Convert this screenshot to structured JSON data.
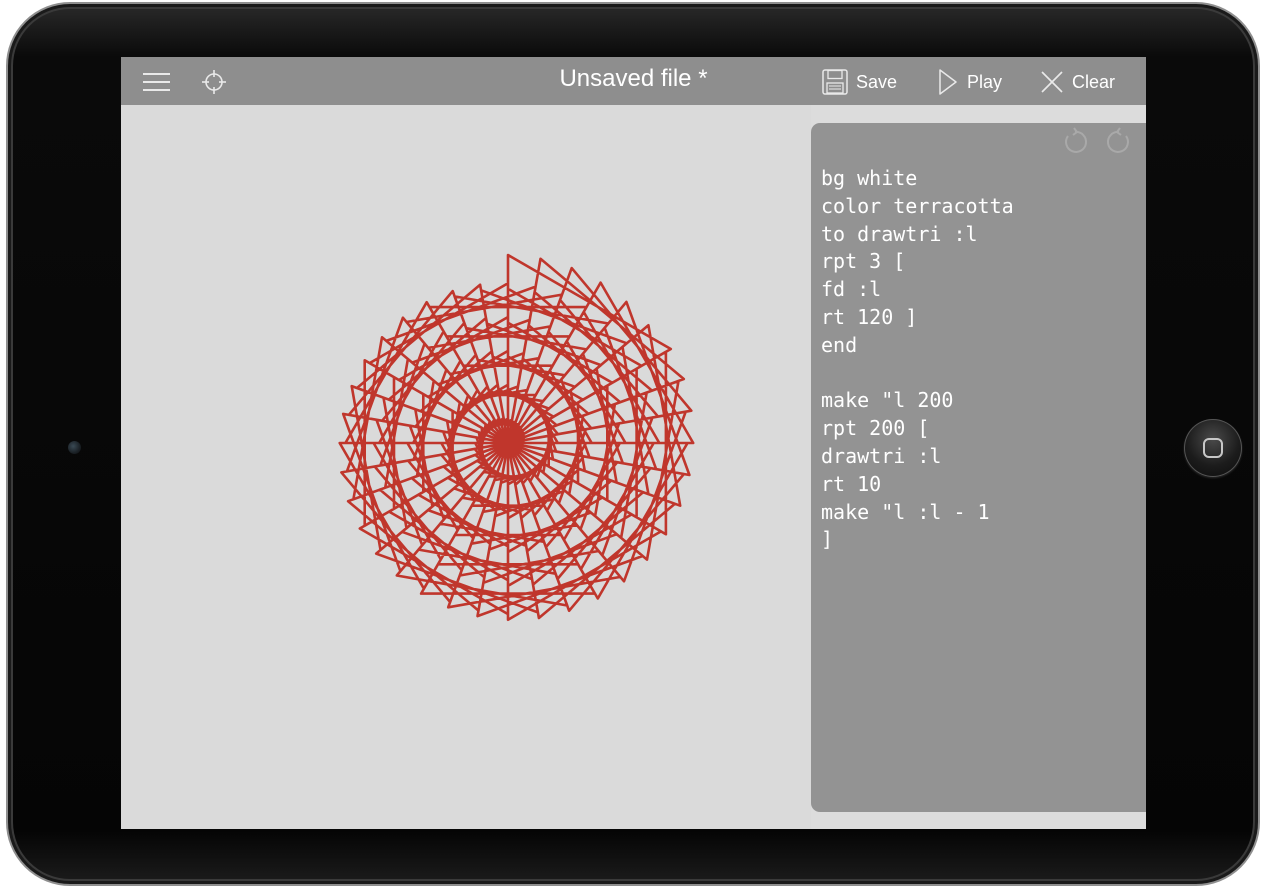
{
  "app": {
    "title": "Unsaved file *",
    "accent_color": "#c0362c",
    "toolbar_color": "#8e8e8e"
  },
  "toolbar": {
    "menu_icon": "hamburger-menu-icon",
    "locate_icon": "crosshair-icon",
    "save_label": "Save",
    "play_label": "Play",
    "clear_label": "Clear"
  },
  "editor": {
    "undo_icon": "undo-icon",
    "redo_icon": "redo-icon",
    "lines": [
      "bg white",
      "color terracotta",
      "to drawtri :l",
      "rpt 3 [",
      "fd :l",
      "rt 120 ]",
      "end",
      "",
      "make \"l 200",
      "rpt 200 [",
      "drawtri :l",
      "rt 10",
      "make \"l :l - 1",
      "]"
    ]
  },
  "drawing": {
    "pen_color": "#c0362c",
    "triangle_start_length": 200,
    "repeat_count": 200,
    "turn_degrees": 10,
    "length_step": -1
  }
}
